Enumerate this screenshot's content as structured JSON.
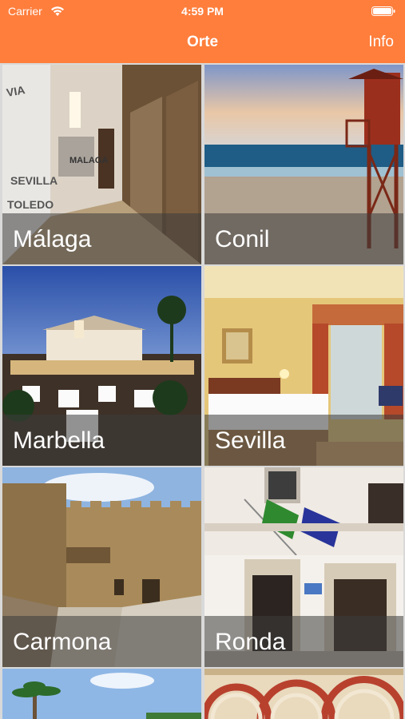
{
  "status_bar": {
    "carrier": "Carrier",
    "time": "4:59 PM"
  },
  "nav": {
    "title": "Orte",
    "info_label": "Info"
  },
  "colors": {
    "accent": "#ff7e3c"
  },
  "places": [
    {
      "name": "Málaga"
    },
    {
      "name": "Conil"
    },
    {
      "name": "Marbella"
    },
    {
      "name": "Sevilla"
    },
    {
      "name": "Carmona"
    },
    {
      "name": "Ronda"
    },
    {
      "name": ""
    },
    {
      "name": ""
    }
  ]
}
